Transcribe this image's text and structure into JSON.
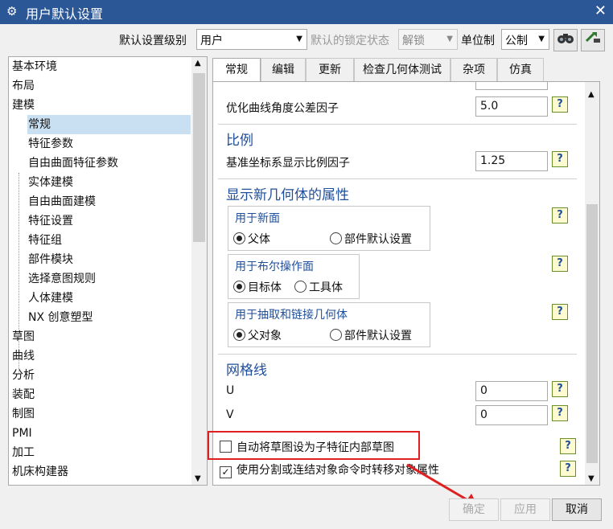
{
  "window": {
    "title": "用户默认设置",
    "gear_icon": "⚙",
    "close_icon": "✕"
  },
  "toolbar": {
    "level_label": "默认设置级别",
    "level_value": "用户",
    "lock_state_label": "默认的锁定状态",
    "lock_state_value": "解锁",
    "unit_label": "单位制",
    "unit_value": "公制",
    "icons": [
      "binoculars-icon",
      "import-export-icon"
    ]
  },
  "tree": {
    "items": [
      {
        "label": "基本环境",
        "level": 0
      },
      {
        "label": "布局",
        "level": 0
      },
      {
        "label": "建模",
        "level": 0
      },
      {
        "label": "常规",
        "level": 1,
        "selected": true
      },
      {
        "label": "特征参数",
        "level": 1
      },
      {
        "label": "自由曲面特征参数",
        "level": 1
      },
      {
        "label": "实体建模",
        "level": 1
      },
      {
        "label": "自由曲面建模",
        "level": 1
      },
      {
        "label": "特征设置",
        "level": 1
      },
      {
        "label": "特征组",
        "level": 1
      },
      {
        "label": "部件模块",
        "level": 1
      },
      {
        "label": "选择意图规则",
        "level": 1
      },
      {
        "label": "人体建模",
        "level": 1
      },
      {
        "label": "NX 创意塑型",
        "level": 1
      },
      {
        "label": "草图",
        "level": 0
      },
      {
        "label": "曲线",
        "level": 0
      },
      {
        "label": "分析",
        "level": 0
      },
      {
        "label": "装配",
        "level": 0
      },
      {
        "label": "制图",
        "level": 0
      },
      {
        "label": "PMI",
        "level": 0
      },
      {
        "label": "加工",
        "level": 0
      },
      {
        "label": "机床构建器",
        "level": 0
      }
    ]
  },
  "tabs": [
    {
      "label": "常规",
      "active": true
    },
    {
      "label": "编辑"
    },
    {
      "label": "更新"
    },
    {
      "label": "检查几何体测试"
    },
    {
      "label": "杂项"
    },
    {
      "label": "仿真"
    }
  ],
  "panel": {
    "curve_angle_label": "优化曲线角度公差因子",
    "curve_angle_value": "5.0",
    "scale_title": "比例",
    "scale_label": "基准坐标系显示比例因子",
    "scale_value": "1.25",
    "props_title": "显示新几何体的属性",
    "group_new_face": {
      "title": "用于新面",
      "opt1": "父体",
      "opt2": "部件默认设置",
      "selected": "父体"
    },
    "group_boolean": {
      "title": "用于布尔操作面",
      "opt1": "目标体",
      "opt2": "工具体",
      "selected": "目标体"
    },
    "group_extract": {
      "title": "用于抽取和链接几何体",
      "opt1": "父对象",
      "opt2": "部件默认设置",
      "selected": "父对象"
    },
    "grid_title": "网格线",
    "grid_u_label": "U",
    "grid_u_value": "0",
    "grid_v_label": "V",
    "grid_v_value": "0",
    "chk_sketch_label": "自动将草图设为子特征内部草图",
    "chk_sketch_checked": false,
    "chk_split_label": "使用分割或连结对象命令时转移对象属性",
    "chk_split_checked": true,
    "help_icon": "?"
  },
  "buttons": {
    "ok": "确定",
    "apply": "应用",
    "cancel": "取消"
  },
  "colors": {
    "titlebar": "#2b5797",
    "section": "#1f4e9a",
    "highlight": "#e02020"
  }
}
